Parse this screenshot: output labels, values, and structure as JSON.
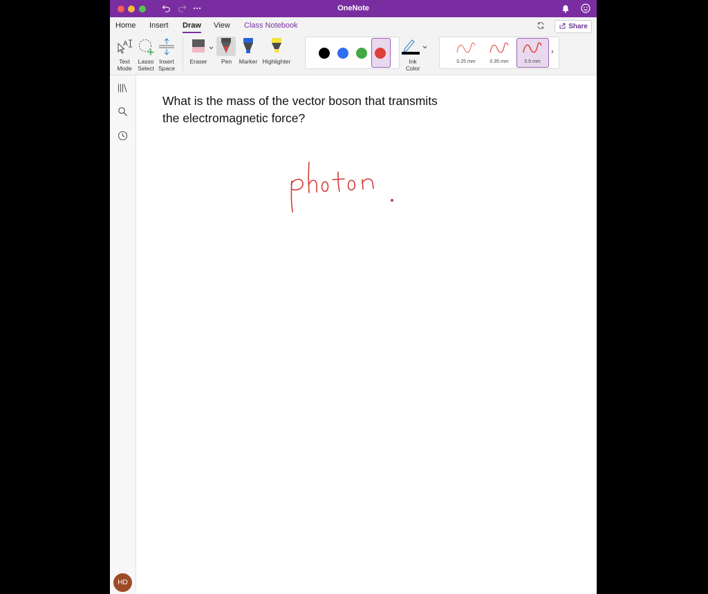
{
  "window": {
    "title": "OneNote",
    "accent": "#7a2da0"
  },
  "title_bar": {
    "icons": [
      "undo-icon",
      "redo-icon",
      "more-icon",
      "bell-icon",
      "smiley-icon"
    ]
  },
  "tabs": [
    {
      "label": "Home"
    },
    {
      "label": "Insert"
    },
    {
      "label": "Draw",
      "active": true
    },
    {
      "label": "View"
    },
    {
      "label": "Class Notebook"
    }
  ],
  "share": {
    "label": "Share"
  },
  "ribbon": {
    "text_mode": {
      "line1": "Text",
      "line2": "Mode"
    },
    "lasso_select": {
      "line1": "Lasso",
      "line2": "Select"
    },
    "insert_space": {
      "line1": "Insert",
      "line2": "Space"
    },
    "eraser": "Eraser",
    "pen": "Pen",
    "marker": "Marker",
    "highlighter": "Highlighter",
    "colors": [
      "#000000",
      "#2f6ef0",
      "#43a843",
      "#e0403a"
    ],
    "selected_color": "#e0403a",
    "ink_color": {
      "line1": "Ink",
      "line2": "Color"
    },
    "thickness": [
      "0.25 mm",
      "0.35 mm",
      "0.5 mm"
    ],
    "selected_thickness": "0.5 mm",
    "more_chevron": "›"
  },
  "sidebar": {
    "icons": [
      "notebooks-icon",
      "search-icon",
      "recent-icon"
    ],
    "avatar": "HD"
  },
  "page": {
    "question_line1": "What is the mass of the vector boson that transmits",
    "question_line2": "the electromagnetic force?",
    "ink_answer": "photon"
  }
}
